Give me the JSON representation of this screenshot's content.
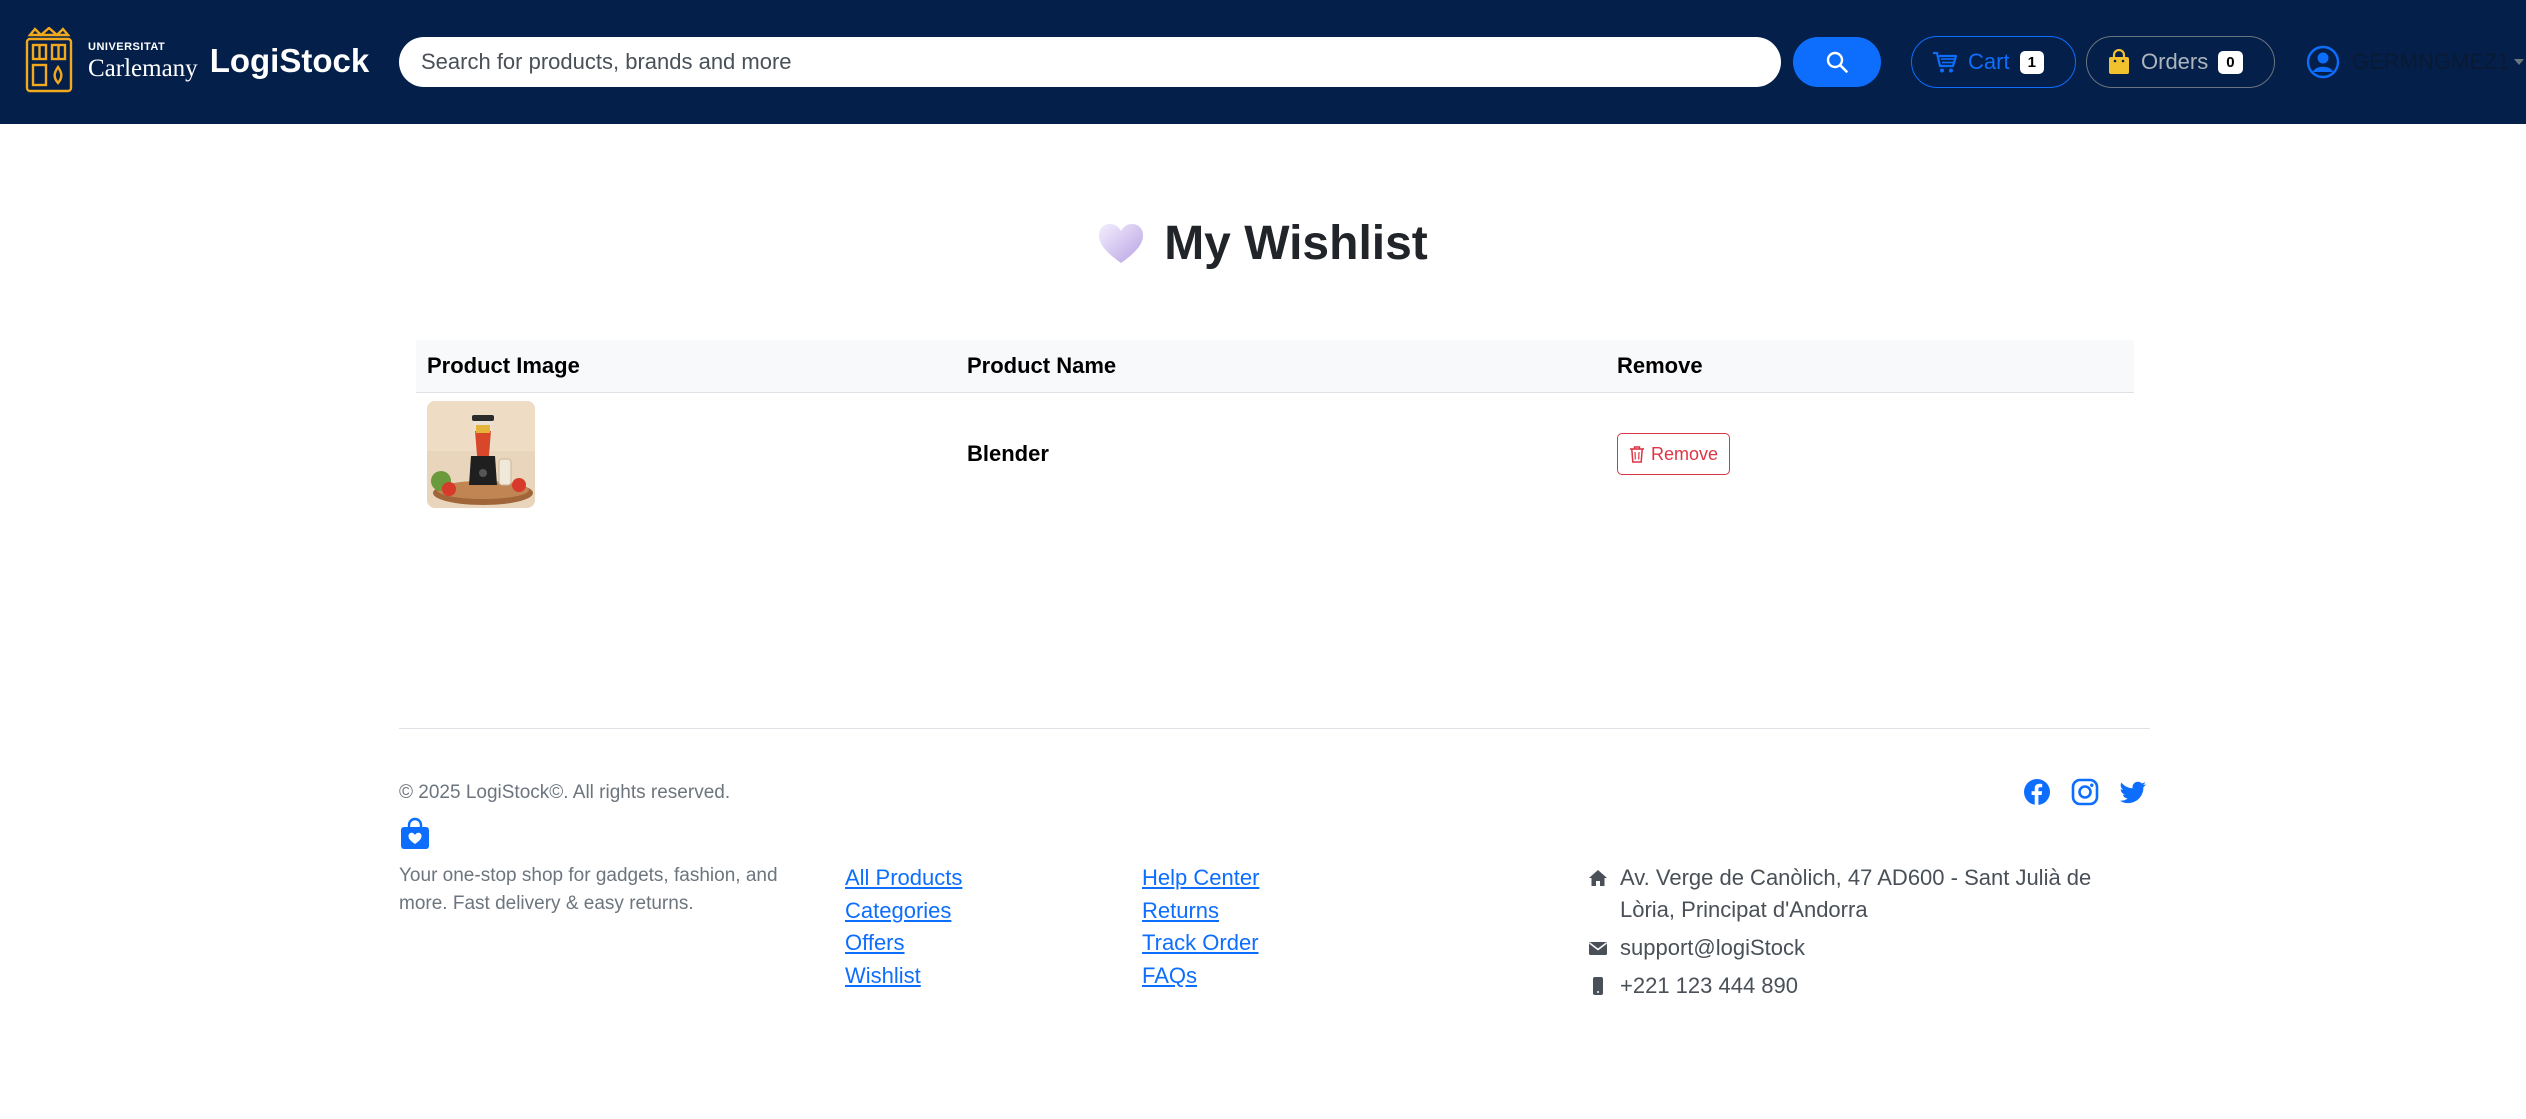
{
  "header": {
    "logo_small": "UNIVERSITAT",
    "logo_big": "Carlemany",
    "brand": "LogiStock",
    "search_placeholder": "Search for products, brands and more",
    "cart_label": "Cart",
    "cart_count": "1",
    "orders_label": "Orders",
    "orders_count": "0",
    "username": "GERMNGMEZ1"
  },
  "page": {
    "title": "My Wishlist"
  },
  "table": {
    "headers": [
      "Product Image",
      "Product Name",
      "Remove"
    ],
    "rows": [
      {
        "name": "Blender",
        "remove_label": "Remove"
      }
    ]
  },
  "footer": {
    "copyright": "© 2025 LogiStock©. All rights reserved.",
    "tagline": "Your one-stop shop for gadgets, fashion, and more. Fast delivery & easy returns.",
    "links_col1": [
      "All Products",
      "Categories",
      "Offers",
      "Wishlist"
    ],
    "links_col2": [
      "Help Center",
      "Returns",
      "Track Order",
      "FAQs"
    ],
    "address": "Av. Verge de Canòlich, 47 AD600 - Sant Julià de Lòria, Principat d'Andorra",
    "email": "support@logiStock",
    "phone": "+221 123 444 890",
    "socials": [
      "facebook-icon",
      "instagram-icon",
      "twitter-icon"
    ]
  },
  "colors": {
    "navbar": "#031f4a",
    "primary": "#0d6efd",
    "danger": "#dc3545",
    "logo_gold": "#f2a91e"
  }
}
